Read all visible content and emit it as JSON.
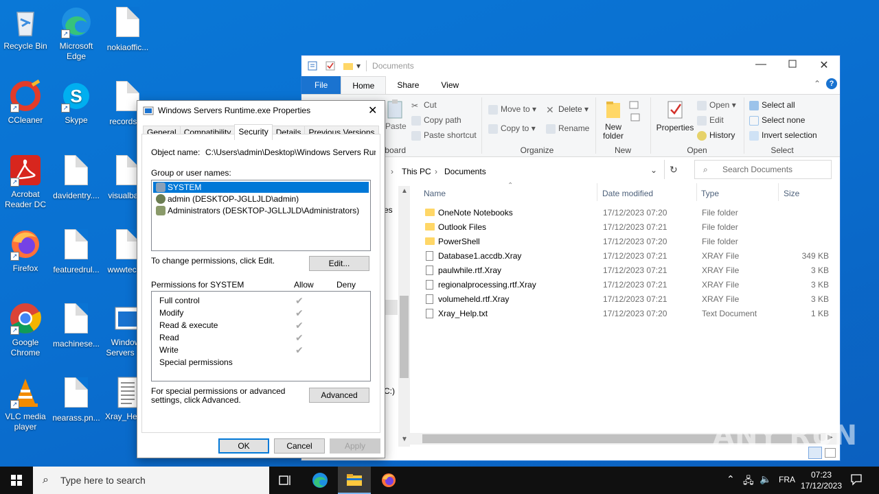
{
  "desktop": {
    "icons": [
      {
        "label": "Recycle Bin"
      },
      {
        "label": "Microsoft Edge"
      },
      {
        "label": "nokiaoffic..."
      },
      {
        "label": "CCleaner"
      },
      {
        "label": "Skype"
      },
      {
        "label": "recordsr..."
      },
      {
        "label": "Acrobat Reader DC"
      },
      {
        "label": "davidentry...."
      },
      {
        "label": "visualbar..."
      },
      {
        "label": "Firefox"
      },
      {
        "label": "featuredrul..."
      },
      {
        "label": "wwwtech..."
      },
      {
        "label": "Google Chrome"
      },
      {
        "label": "machinese..."
      },
      {
        "label": "Windows Servers R..."
      },
      {
        "label": "VLC media player"
      },
      {
        "label": "nearass.pn..."
      },
      {
        "label": "Xray_Help..."
      }
    ]
  },
  "explorer": {
    "title": "Documents",
    "tabs": {
      "file": "File",
      "home": "Home",
      "share": "Share",
      "view": "View"
    },
    "ribbon": {
      "clipboard": {
        "paste": "Paste",
        "cut": "Cut",
        "copy_path": "Copy path",
        "paste_shortcut": "Paste shortcut",
        "label": "Clipboard"
      },
      "organize": {
        "move_to": "Move to",
        "copy_to": "Copy to",
        "delete": "Delete",
        "rename": "Rename",
        "label": "Organize"
      },
      "new": {
        "new_folder": "New folder",
        "label": "New"
      },
      "open": {
        "properties": "Properties",
        "open": "Open",
        "edit": "Edit",
        "history": "History",
        "label": "Open"
      },
      "select": {
        "select_all": "Select all",
        "select_none": "Select none",
        "invert": "Invert selection",
        "label": "Select"
      }
    },
    "breadcrumb": {
      "this_pc": "This PC",
      "documents": "Documents"
    },
    "search_placeholder": "Search Documents",
    "columns": {
      "name": "Name",
      "date": "Date modified",
      "type": "Type",
      "size": "Size"
    },
    "files": [
      {
        "name": "OneNote Notebooks",
        "date": "17/12/2023 07:20",
        "type": "File folder",
        "size": "",
        "kind": "folder"
      },
      {
        "name": "Outlook Files",
        "date": "17/12/2023 07:21",
        "type": "File folder",
        "size": "",
        "kind": "folder"
      },
      {
        "name": "PowerShell",
        "date": "17/12/2023 07:20",
        "type": "File folder",
        "size": "",
        "kind": "folder"
      },
      {
        "name": "Database1.accdb.Xray",
        "date": "17/12/2023 07:21",
        "type": "XRAY File",
        "size": "349 KB",
        "kind": "file"
      },
      {
        "name": "paulwhile.rtf.Xray",
        "date": "17/12/2023 07:21",
        "type": "XRAY File",
        "size": "3 KB",
        "kind": "file"
      },
      {
        "name": "regionalprocessing.rtf.Xray",
        "date": "17/12/2023 07:21",
        "type": "XRAY File",
        "size": "3 KB",
        "kind": "file"
      },
      {
        "name": "volumeheld.rtf.Xray",
        "date": "17/12/2023 07:21",
        "type": "XRAY File",
        "size": "3 KB",
        "kind": "file"
      },
      {
        "name": "Xray_Help.txt",
        "date": "17/12/2023 07:20",
        "type": "Text Document",
        "size": "1 KB",
        "kind": "file"
      }
    ],
    "nav_fragments": {
      "f1": "es",
      "f2": "C:)"
    }
  },
  "dialog": {
    "title": "Windows Servers Runtime.exe Properties",
    "tabs": [
      "General",
      "Compatibility",
      "Security",
      "Details",
      "Previous Versions"
    ],
    "object_name_label": "Object name:",
    "object_name_value": "C:\\Users\\admin\\Desktop\\Windows Servers Runtir",
    "group_label": "Group or user names:",
    "users": [
      "SYSTEM",
      "admin (DESKTOP-JGLLJLD\\admin)",
      "Administrators (DESKTOP-JGLLJLD\\Administrators)"
    ],
    "change_text": "To change permissions, click Edit.",
    "edit_button": "Edit...",
    "perm_label": "Permissions for SYSTEM",
    "allow": "Allow",
    "deny": "Deny",
    "permissions": [
      "Full control",
      "Modify",
      "Read & execute",
      "Read",
      "Write",
      "Special permissions"
    ],
    "special_text": "For special permissions or advanced settings, click Advanced.",
    "advanced_button": "Advanced",
    "ok": "OK",
    "cancel": "Cancel",
    "apply": "Apply"
  },
  "taskbar": {
    "search_placeholder": "Type here to search",
    "lang": "FRA",
    "time": "07:23",
    "date": "17/12/2023"
  },
  "watermark": "ANY RUN",
  "colors": {
    "accent": "#0078d7",
    "desktop": "#0a6fd0",
    "selection": "#0078d7"
  }
}
